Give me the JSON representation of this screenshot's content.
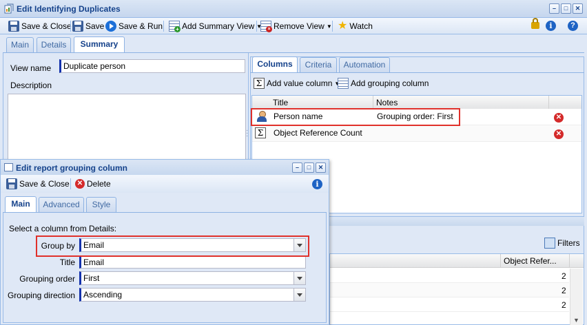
{
  "window": {
    "title": "Edit Identifying Duplicates",
    "controls": [
      "minimize",
      "maximize",
      "close"
    ]
  },
  "toolbar": {
    "save_close": "Save & Close",
    "save": "Save",
    "save_run": "Save & Run",
    "add_summary_view": "Add Summary View",
    "remove_view": "Remove View",
    "watch": "Watch"
  },
  "main_tabs": [
    {
      "label": "Main",
      "active": false
    },
    {
      "label": "Details",
      "active": false
    },
    {
      "label": "Summary",
      "active": true
    }
  ],
  "summary_form": {
    "view_name_label": "View name",
    "view_name_value": "Duplicate person",
    "description_label": "Description"
  },
  "right_tabs": [
    {
      "label": "Columns",
      "active": true
    },
    {
      "label": "Criteria",
      "active": false
    },
    {
      "label": "Automation",
      "active": false
    }
  ],
  "columns_toolbar": {
    "add_value_column": "Add value column",
    "add_grouping_column": "Add grouping column"
  },
  "columns_grid": {
    "headers": [
      "Title",
      "Notes"
    ],
    "rows": [
      {
        "icon": "person-icon",
        "title": "Person name",
        "notes": "Grouping order: First"
      },
      {
        "icon": "sum-icon",
        "title": "Object Reference Count",
        "notes": ""
      }
    ]
  },
  "preview": {
    "filters_label": "Filters",
    "column_header": "Object Refer...",
    "values": [
      "2",
      "2",
      "2"
    ]
  },
  "dialog": {
    "title": "Edit report grouping column",
    "save_close": "Save & Close",
    "delete": "Delete",
    "tabs": [
      {
        "label": "Main",
        "active": true
      },
      {
        "label": "Advanced",
        "active": false
      },
      {
        "label": "Style",
        "active": false
      }
    ],
    "instruction": "Select a column from Details:",
    "fields": {
      "group_by_label": "Group by",
      "group_by_value": "Email",
      "title_label": "Title",
      "title_value": "Email",
      "grouping_order_label": "Grouping order",
      "grouping_order_value": "First",
      "grouping_direction_label": "Grouping direction",
      "grouping_direction_value": "Ascending"
    }
  },
  "colors": {
    "highlight": "#e0302a",
    "title_text": "#15428b",
    "required_marker": "#1533ad"
  }
}
